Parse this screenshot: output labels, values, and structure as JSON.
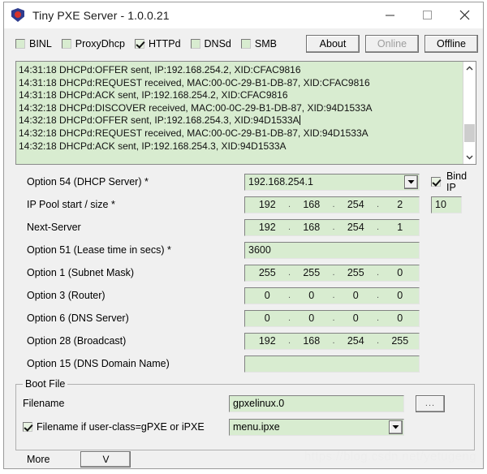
{
  "window": {
    "title": "Tiny PXE Server - 1.0.0.21",
    "icon": "shield-icon",
    "controls": {
      "minimize": "minimize-icon",
      "maximize": "maximize-icon",
      "close": "close-icon"
    }
  },
  "toolbar": {
    "services": [
      {
        "label": "BINL",
        "checked": false
      },
      {
        "label": "ProxyDhcp",
        "checked": false
      },
      {
        "label": "HTTPd",
        "checked": true
      },
      {
        "label": "DNSd",
        "checked": false
      },
      {
        "label": "SMB",
        "checked": false
      }
    ],
    "buttons": [
      {
        "label": "About",
        "enabled": true
      },
      {
        "label": "Online",
        "enabled": false
      },
      {
        "label": "Offline",
        "enabled": true
      }
    ]
  },
  "log": {
    "lines": [
      "14:31:18 DHCPd:OFFER sent, IP:192.168.254.2, XID:CFAC9816",
      "14:31:18 DHCPd:REQUEST received, MAC:00-0C-29-B1-DB-87, XID:CFAC9816",
      "14:31:18 DHCPd:ACK sent, IP:192.168.254.2, XID:CFAC9816",
      "14:32:18 DHCPd:DISCOVER received, MAC:00-0C-29-B1-DB-87, XID:94D1533A",
      "14:32:18 DHCPd:OFFER sent, IP:192.168.254.3, XID:94D1533A",
      "14:32:18 DHCPd:REQUEST received, MAC:00-0C-29-B1-DB-87, XID:94D1533A",
      "14:32:18 DHCPd:ACK sent, IP:192.168.254.3, XID:94D1533A"
    ],
    "caret_line_index": 4,
    "scrollbar": {
      "up": "chevron-up-icon",
      "down": "chevron-down-icon"
    }
  },
  "options": {
    "dhcp_server": {
      "label": "Option 54 (DHCP Server) *",
      "value": "192.168.254.1"
    },
    "bind_ip": {
      "label": "Bind IP",
      "checked": true
    },
    "pool_start": {
      "label": "IP Pool start / size *",
      "octets": [
        "192",
        "168",
        "254",
        "2"
      ],
      "size": "10"
    },
    "next_server": {
      "label": "Next-Server",
      "octets": [
        "192",
        "168",
        "254",
        "1"
      ]
    },
    "lease_time": {
      "label": "Option 51 (Lease time in secs) *",
      "value": "3600"
    },
    "subnet_mask": {
      "label": "Option 1  (Subnet Mask)",
      "octets": [
        "255",
        "255",
        "255",
        "0"
      ]
    },
    "router": {
      "label": "Option 3  (Router)",
      "octets": [
        "0",
        "0",
        "0",
        "0"
      ]
    },
    "dns_server": {
      "label": "Option 6  (DNS Server)",
      "octets": [
        "0",
        "0",
        "0",
        "0"
      ]
    },
    "broadcast": {
      "label": "Option 28 (Broadcast)",
      "octets": [
        "192",
        "168",
        "254",
        "255"
      ]
    },
    "dns_domain": {
      "label": "Option 15 (DNS Domain Name)",
      "value": ""
    }
  },
  "boot_file": {
    "group_title": "Boot File",
    "filename": {
      "label": "Filename",
      "value": "gpxelinux.0"
    },
    "browse_button": "...",
    "gpxe": {
      "label": "Filename if user-class=gPXE  or iPXE",
      "checked": true,
      "value": "menu.ipxe"
    }
  },
  "footer": {
    "more_label": "More",
    "more_button": "V",
    "watermark": "https://blog.csdn.net/yetugeng"
  }
}
